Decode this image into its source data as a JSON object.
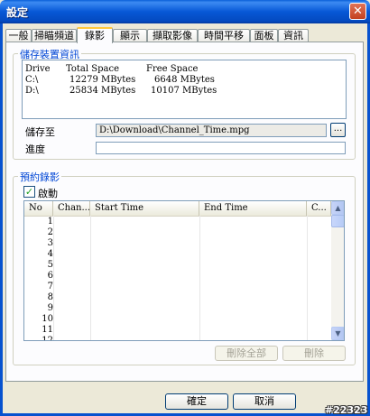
{
  "window": {
    "title": "設定",
    "close_glyph": "✕"
  },
  "tabs": [
    {
      "label": "一般"
    },
    {
      "label": "掃瞄頻道"
    },
    {
      "label": "錄影"
    },
    {
      "label": "顯示"
    },
    {
      "label": "擷取影像"
    },
    {
      "label": "時間平移"
    },
    {
      "label": "面板"
    },
    {
      "label": "資訊"
    }
  ],
  "storage": {
    "group_label": "儲存裝置資訊",
    "headers": {
      "drive": "Drive",
      "total": "Total Space",
      "free": "Free Space"
    },
    "drives": [
      {
        "drive": "C:\\",
        "total": "12279 MBytes",
        "free": "6648 MBytes"
      },
      {
        "drive": "D:\\",
        "total": "25834 MBytes",
        "free": "10107 MBytes"
      }
    ],
    "save_to_label": "儲存至",
    "save_path": "D:\\Download\\Channel_Time.mpg",
    "browse_label": "...",
    "progress_label": "進度",
    "progress_value": 0
  },
  "schedule": {
    "group_label": "預約錄影",
    "enable_label": "啟動",
    "enable_checked": true,
    "check_glyph": "✓",
    "columns": [
      "No",
      "Chan...",
      "Start Time",
      "End Time",
      "C..."
    ],
    "rows": [
      "1",
      "2",
      "3",
      "4",
      "5",
      "6",
      "7",
      "8",
      "9",
      "10",
      "11",
      "12"
    ],
    "delete_all_label": "刪除全部",
    "delete_label": "刪除"
  },
  "scroll": {
    "up_glyph": "▲",
    "down_glyph": "▼"
  },
  "footer": {
    "ok_label": "確定",
    "cancel_label": "取消"
  },
  "watermark": "#22323"
}
